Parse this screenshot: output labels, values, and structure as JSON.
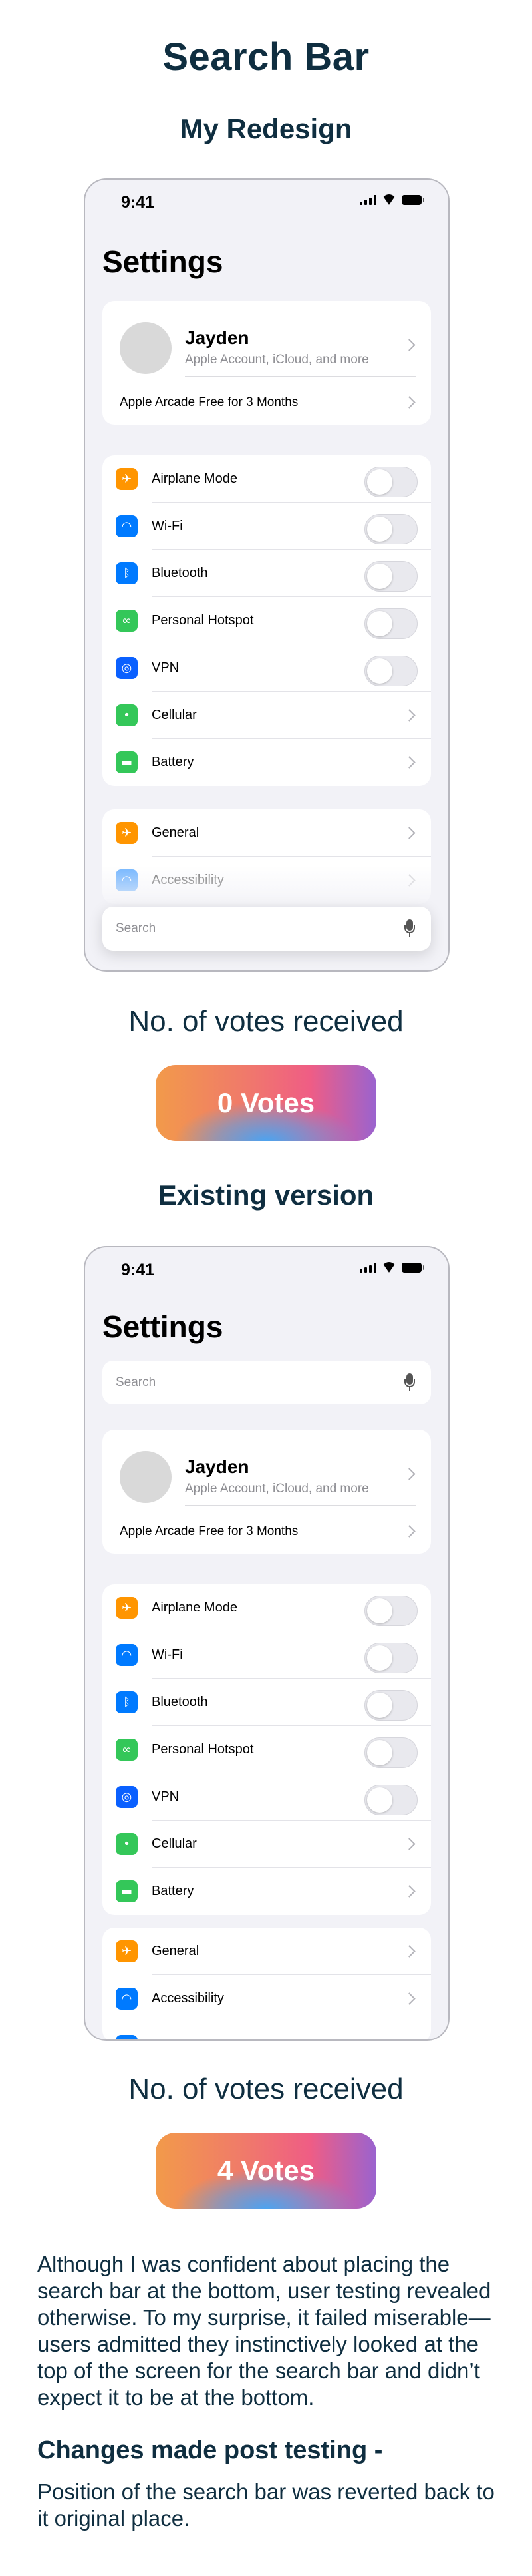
{
  "page": {
    "title": "Search Bar"
  },
  "redesign": {
    "title": "My Redesign",
    "phone": {
      "time": "9:41",
      "settings_title": "Settings",
      "account": {
        "name": "Jayden",
        "subtitle": "Apple Account, iCloud, and more",
        "arcade": "Apple Arcade Free for 3 Months"
      },
      "connectivity": [
        {
          "label": "Airplane Mode",
          "icon": "airplane-icon",
          "color": "#ff9500",
          "control": "toggle"
        },
        {
          "label": "Wi-Fi",
          "icon": "wifi-icon",
          "color": "#007aff",
          "control": "toggle"
        },
        {
          "label": "Bluetooth",
          "icon": "bluetooth-icon",
          "color": "#007aff",
          "control": "toggle"
        },
        {
          "label": "Personal Hotspot",
          "icon": "hotspot-icon",
          "color": "#34c759",
          "control": "toggle"
        },
        {
          "label": "VPN",
          "icon": "vpn-globe-icon",
          "color": "#0a60ff",
          "control": "toggle"
        },
        {
          "label": "Cellular",
          "icon": "cellular-icon",
          "color": "#34c759",
          "control": "chevron"
        },
        {
          "label": "Battery",
          "icon": "battery-icon",
          "color": "#34c759",
          "control": "chevron"
        }
      ],
      "general": [
        {
          "label": "General",
          "icon": "gear-icon",
          "color": "#ff9500"
        },
        {
          "label": "Accessibility",
          "icon": "accessibility-icon",
          "color": "#007aff"
        }
      ],
      "search_placeholder": "Search"
    },
    "votes_heading": "No. of votes received",
    "votes": "0 Votes"
  },
  "existing": {
    "title": "Existing version",
    "phone": {
      "time": "9:41",
      "settings_title": "Settings",
      "search_placeholder": "Search",
      "account": {
        "name": "Jayden",
        "subtitle": "Apple Account, iCloud, and more",
        "arcade": "Apple Arcade Free for 3 Months"
      },
      "connectivity": [
        {
          "label": "Airplane Mode",
          "icon": "airplane-icon",
          "color": "#ff9500",
          "control": "toggle"
        },
        {
          "label": "Wi-Fi",
          "icon": "wifi-icon",
          "color": "#007aff",
          "control": "toggle"
        },
        {
          "label": "Bluetooth",
          "icon": "bluetooth-icon",
          "color": "#007aff",
          "control": "toggle"
        },
        {
          "label": "Personal Hotspot",
          "icon": "hotspot-icon",
          "color": "#34c759",
          "control": "toggle"
        },
        {
          "label": "VPN",
          "icon": "vpn-globe-icon",
          "color": "#0a60ff",
          "control": "toggle"
        },
        {
          "label": "Cellular",
          "icon": "cellular-icon",
          "color": "#34c759",
          "control": "chevron"
        },
        {
          "label": "Battery",
          "icon": "battery-icon",
          "color": "#34c759",
          "control": "chevron"
        }
      ],
      "general": [
        {
          "label": "General",
          "icon": "gear-icon",
          "color": "#ff9500"
        },
        {
          "label": "Accessibility",
          "icon": "accessibility-icon",
          "color": "#007aff"
        }
      ]
    },
    "votes_heading": "No. of votes received",
    "votes": "4 Votes"
  },
  "findings": "Although I was confident about placing the search bar at the bottom, user testing revealed otherwise. To my surprise, it failed miserable— users admitted they instinctively looked at the top of the screen for the search bar and didn’t expect it to be at the bottom.",
  "changes": {
    "title": "Changes made post testing -",
    "text": "Position of the search bar was reverted back to it original place."
  },
  "colors": {
    "heading": "#0f2e40",
    "ios_background": "#f2f2f7",
    "vote_gradient": [
      "#f29a4a",
      "#ef5d85",
      "#4da3ef",
      "#9a63cf"
    ]
  }
}
